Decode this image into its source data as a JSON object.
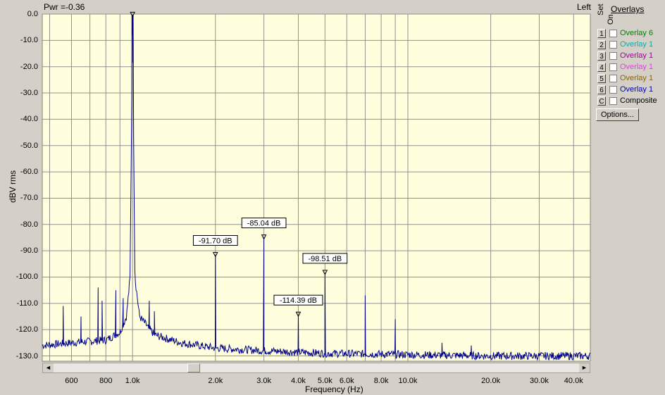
{
  "header": {
    "power_readout": "Pwr =-0.36",
    "channel": "Left"
  },
  "chart_data": {
    "type": "line",
    "xlabel": "Frequency (Hz)",
    "ylabel": "dBV rms",
    "x_scale": "log",
    "xlim": [
      470,
      46000
    ],
    "ylim": [
      -132,
      0
    ],
    "grid": true,
    "x_ticks": [
      {
        "value": 600,
        "label": "600"
      },
      {
        "value": 800,
        "label": "800"
      },
      {
        "value": 1000,
        "label": "1.0k"
      },
      {
        "value": 2000,
        "label": "2.0k"
      },
      {
        "value": 3000,
        "label": "3.0k"
      },
      {
        "value": 4000,
        "label": "4.0k"
      },
      {
        "value": 5000,
        "label": "5.0k"
      },
      {
        "value": 6000,
        "label": "6.0k"
      },
      {
        "value": 8000,
        "label": "8.0k"
      },
      {
        "value": 10000,
        "label": "10.0k"
      },
      {
        "value": 20000,
        "label": "20.0k"
      },
      {
        "value": 30000,
        "label": "30.0k"
      },
      {
        "value": 40000,
        "label": "40.0k"
      }
    ],
    "minor_x_gridlines": [
      500,
      700,
      900,
      7000,
      9000,
      50000
    ],
    "y_ticks": [
      {
        "value": 0,
        "label": "0.0"
      },
      {
        "value": -10,
        "label": "-10.0"
      },
      {
        "value": -20,
        "label": "-20.0"
      },
      {
        "value": -30,
        "label": "-30.0"
      },
      {
        "value": -40,
        "label": "-40.0"
      },
      {
        "value": -50,
        "label": "-50.0"
      },
      {
        "value": -60,
        "label": "-60.0"
      },
      {
        "value": -70,
        "label": "-70.0"
      },
      {
        "value": -80,
        "label": "-80.0"
      },
      {
        "value": -90,
        "label": "-90.0"
      },
      {
        "value": -100,
        "label": "-100.0"
      },
      {
        "value": -110,
        "label": "-110.0"
      },
      {
        "value": -120,
        "label": "-120.0"
      },
      {
        "value": -130,
        "label": "-130.0"
      }
    ],
    "noise_floor": [
      [
        470,
        -126
      ],
      [
        600,
        -125
      ],
      [
        800,
        -124
      ],
      [
        900,
        -121
      ],
      [
        950,
        -115
      ],
      [
        980,
        -100
      ],
      [
        1000,
        -0.36
      ],
      [
        1020,
        -100
      ],
      [
        1060,
        -115
      ],
      [
        1200,
        -122
      ],
      [
        1500,
        -125
      ],
      [
        2000,
        -127
      ],
      [
        3000,
        -128
      ],
      [
        5000,
        -129
      ],
      [
        10000,
        -129.5
      ],
      [
        20000,
        -130
      ],
      [
        46000,
        -130
      ]
    ],
    "spurs": [
      {
        "x": 560,
        "y": -111
      },
      {
        "x": 650,
        "y": -115
      },
      {
        "x": 750,
        "y": -104
      },
      {
        "x": 775,
        "y": -109
      },
      {
        "x": 870,
        "y": -105
      },
      {
        "x": 925,
        "y": -108
      },
      {
        "x": 1150,
        "y": -109
      },
      {
        "x": 1200,
        "y": -113
      },
      {
        "x": 7000,
        "y": -107
      },
      {
        "x": 9000,
        "y": -116
      },
      {
        "x": 13300,
        "y": -125
      },
      {
        "x": 17000,
        "y": -126
      }
    ],
    "peaks": [
      {
        "x": 1000,
        "y": -0.36
      },
      {
        "x": 2000,
        "y": -91.7,
        "label": "-91.70 dB"
      },
      {
        "x": 3000,
        "y": -85.04,
        "label": "-85.04 dB"
      },
      {
        "x": 4000,
        "y": -114.39,
        "label": "-114.39 dB"
      },
      {
        "x": 5000,
        "y": -98.51,
        "label": "-98.51 dB"
      }
    ],
    "colors": {
      "background": "#ffffde",
      "grid": "#909090",
      "trace": "#00008b"
    }
  },
  "overlays": {
    "title": "Overlays",
    "set_header": "Set",
    "on_header": "On",
    "items": [
      {
        "key": "1",
        "label": "Overlay 6",
        "color": "#008000",
        "checked": false
      },
      {
        "key": "2",
        "label": "Overlay 1",
        "color": "#00b0b0",
        "checked": false
      },
      {
        "key": "3",
        "label": "Overlay 1",
        "color": "#a000a0",
        "checked": false
      },
      {
        "key": "4",
        "label": "Overlay 1",
        "color": "#e040e0",
        "checked": false
      },
      {
        "key": "5",
        "label": "Overlay 1",
        "color": "#906000",
        "checked": false
      },
      {
        "key": "6",
        "label": "Overlay 1",
        "color": "#0000c0",
        "checked": false
      },
      {
        "key": "C",
        "label": "Composite",
        "color": "#000000",
        "checked": false
      }
    ],
    "options_label": "Options..."
  },
  "scrollbar": {
    "left_arrow": "◄",
    "right_arrow": "►",
    "position": 0.26
  }
}
